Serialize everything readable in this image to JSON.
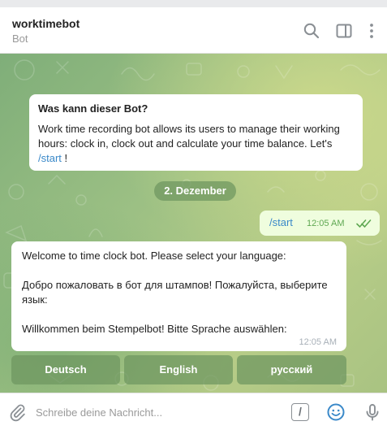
{
  "header": {
    "title": "worktimebot",
    "subtitle": "Bot",
    "icons": [
      "search-icon",
      "sidebar-panel-icon",
      "more-vertical-icon"
    ]
  },
  "bot_info": {
    "title": "Was kann dieser Bot?",
    "body": "Work time recording bot allows its users to manage their working hours:  clock in, clock out and calculate your time balance. Let's",
    "command": "/start",
    "suffix": " !"
  },
  "date_separator": "2. Dezember",
  "outgoing_message": {
    "text": "/start",
    "time": "12:05 AM",
    "status": "read"
  },
  "incoming_message": {
    "lines": [
      "Welcome to time clock bot. Please select your language:",
      "",
      "Добро пожаловать в бот для штампов! Пожалуйста, выберите язык:",
      "",
      "Willkommen beim Stempelbot! Bitte Sprache auswählen:"
    ],
    "time": "12:05 AM"
  },
  "keyboard": {
    "buttons": [
      "Deutsch",
      "English",
      "русский"
    ]
  },
  "composer": {
    "placeholder": "Schreibe deine Nachricht...",
    "command_label": "/",
    "icons": [
      "paperclip-icon",
      "emoji-icon",
      "microphone-icon"
    ]
  },
  "colors": {
    "accent_link": "#3a89c9",
    "outgoing_bubble": "#effdde",
    "read_ticks": "#5fa852",
    "pill_bg": "#6e965f"
  }
}
